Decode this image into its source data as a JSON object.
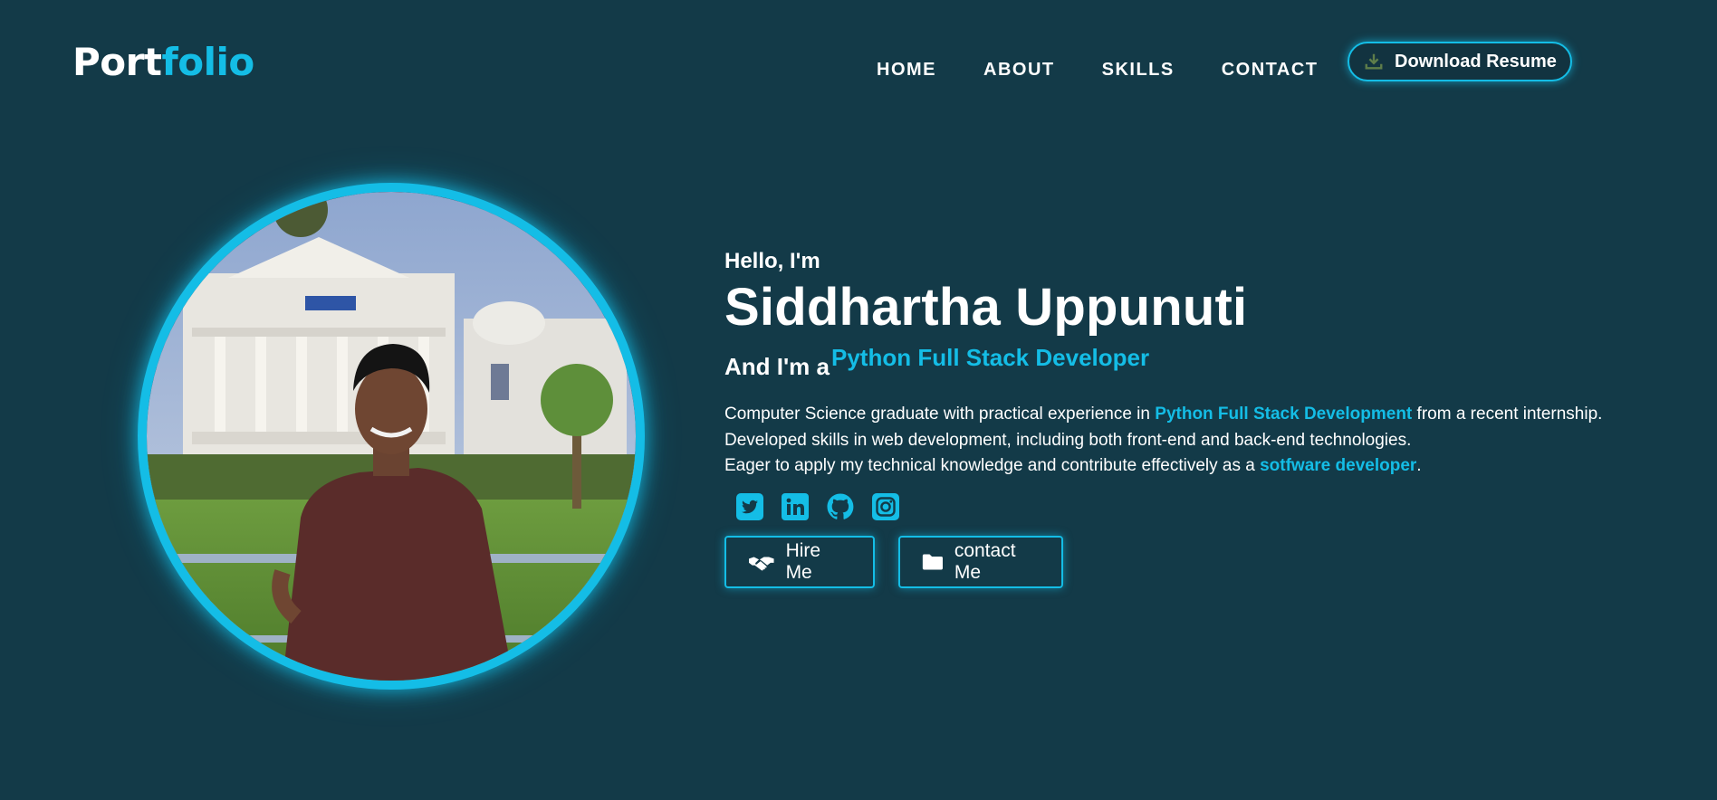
{
  "brand": {
    "logo_part1": "Port",
    "logo_part2": "folio"
  },
  "nav": {
    "items": [
      "HOME",
      "ABOUT",
      "SKILLS",
      "CONTACT"
    ],
    "resume_label": "Download Resume",
    "resume_icon": "download-icon"
  },
  "hero": {
    "greeting": "Hello, I'm",
    "name": "Siddhartha Uppunuti",
    "role_prefix": "And I'm a",
    "role": "Python Full Stack Developer",
    "desc": {
      "l1_a": "Computer Science graduate with practical experience in ",
      "l1_hl": "Python Full Stack Development",
      "l1_b": " from a recent internship.",
      "l2": "Developed skills in web development, including both front-end and back-end technologies.",
      "l3_a": "Eager to apply my technical knowledge and contribute effectively as a ",
      "l3_hl": "sotfware developer",
      "l3_b": "."
    },
    "socials": [
      "twitter-icon",
      "linkedin-icon",
      "github-icon",
      "instagram-icon"
    ],
    "hire_label": "Hire Me",
    "contact_label": "contact Me"
  },
  "colors": {
    "background": "#133a48",
    "accent": "#14bde6",
    "text": "#ffffff"
  }
}
